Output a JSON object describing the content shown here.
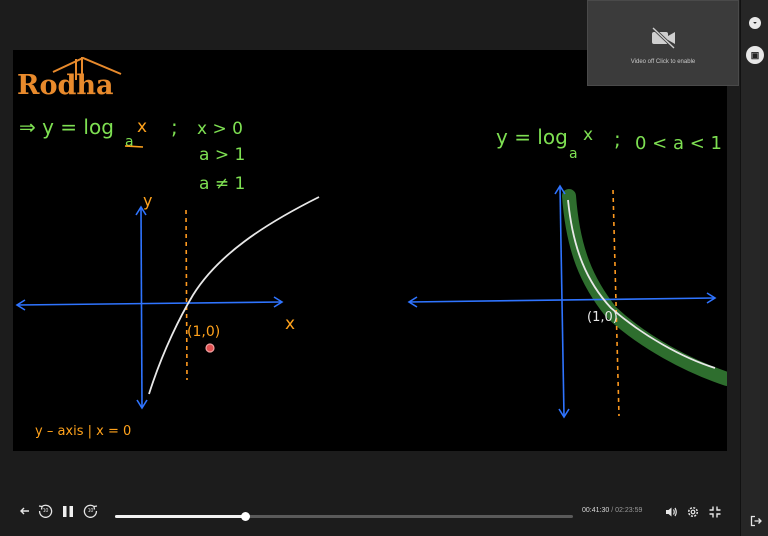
{
  "video": {
    "logo_text": "Rodha",
    "left_note": {
      "equation": "⇒  y = log",
      "subscript": "a",
      "var": "x",
      "sep": ";",
      "cond1": "x > 0",
      "cond2": "a > 1",
      "cond3": "a ≠ 1",
      "y_label": "y",
      "x_label": "x",
      "point_label": "(1,0)",
      "asymptote_note": "y – axis | x = 0"
    },
    "right_note": {
      "equation": "y = log",
      "subscript": "a",
      "var": "x",
      "sep": ";",
      "cond": "0 < a < 1",
      "point_label": "(1,0)"
    },
    "ink_colors": {
      "green": "#7ee052",
      "axes": "#2f74ff",
      "curve": "#e8e8e8",
      "dashed": "#ff9a1f",
      "orange_text": "#ffa21c",
      "highlight": "#2e6e2e"
    }
  },
  "camera_tile": {
    "icon": "video-off-icon",
    "text": "Video off  Click to enable"
  },
  "sidebar": {
    "chat_icon": "chat-icon",
    "notes_icon": "notes-icon",
    "exit_icon": "exit-icon"
  },
  "player": {
    "back_icon": "arrow-left-icon",
    "rewind_label": "10",
    "forward_label": "10",
    "play_state": "paused",
    "progress_fraction": 0.284,
    "current_time": "00:41:30",
    "separator": "/",
    "duration": "02:23:59",
    "volume_icon": "volume-icon",
    "settings_icon": "gear-icon",
    "fullscreen_icon": "exit-fullscreen-icon"
  }
}
